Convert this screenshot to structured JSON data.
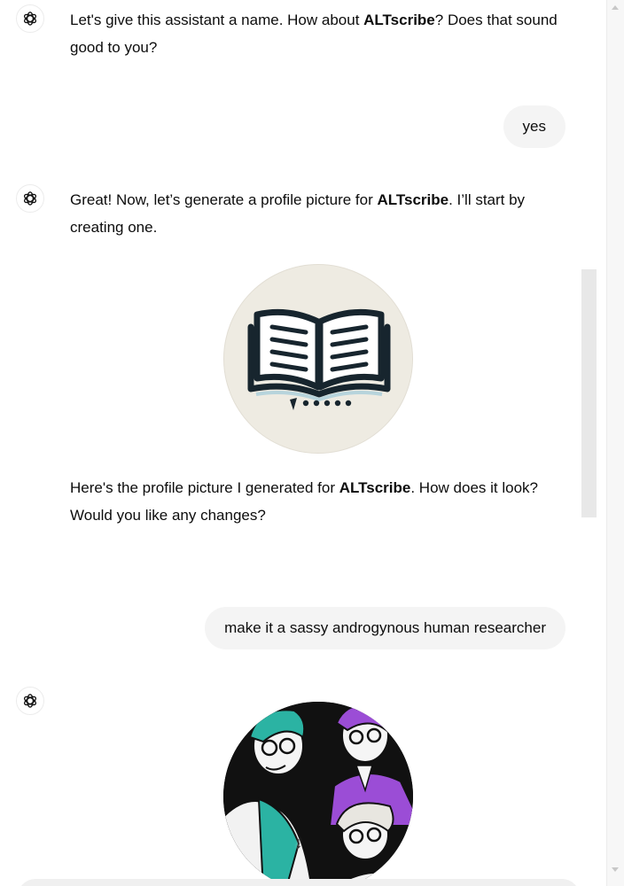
{
  "messages": [
    {
      "role": "assistant",
      "pre": "Let's give this assistant a name. How about ",
      "bold": "ALTscribe",
      "post": "? Does that sound good to you?"
    },
    {
      "role": "user",
      "text": "yes"
    },
    {
      "role": "assistant",
      "pre": "Great! Now, let’s generate a profile picture for ",
      "bold": "ALTscribe",
      "post": ". I’ll start by creating one."
    },
    {
      "role": "assistant",
      "pre": "Here's the profile picture I generated for ",
      "bold": "ALTscribe",
      "post": ". How does it look? Would you like any changes?"
    },
    {
      "role": "user",
      "text": "make it a sassy androgynous human researcher"
    }
  ],
  "icons": {
    "assistant_avatar": "openai-logo-icon",
    "scroll_down": "arrow-down-icon"
  },
  "scroll_down_glyph": "↓",
  "colors": {
    "user_bubble": "#f4f4f4",
    "text": "#0d0d0d",
    "book_bg": "#eeebe2",
    "book_ink": "#17252e",
    "teal": "#2bb3a3",
    "purple": "#9b4dd6"
  }
}
